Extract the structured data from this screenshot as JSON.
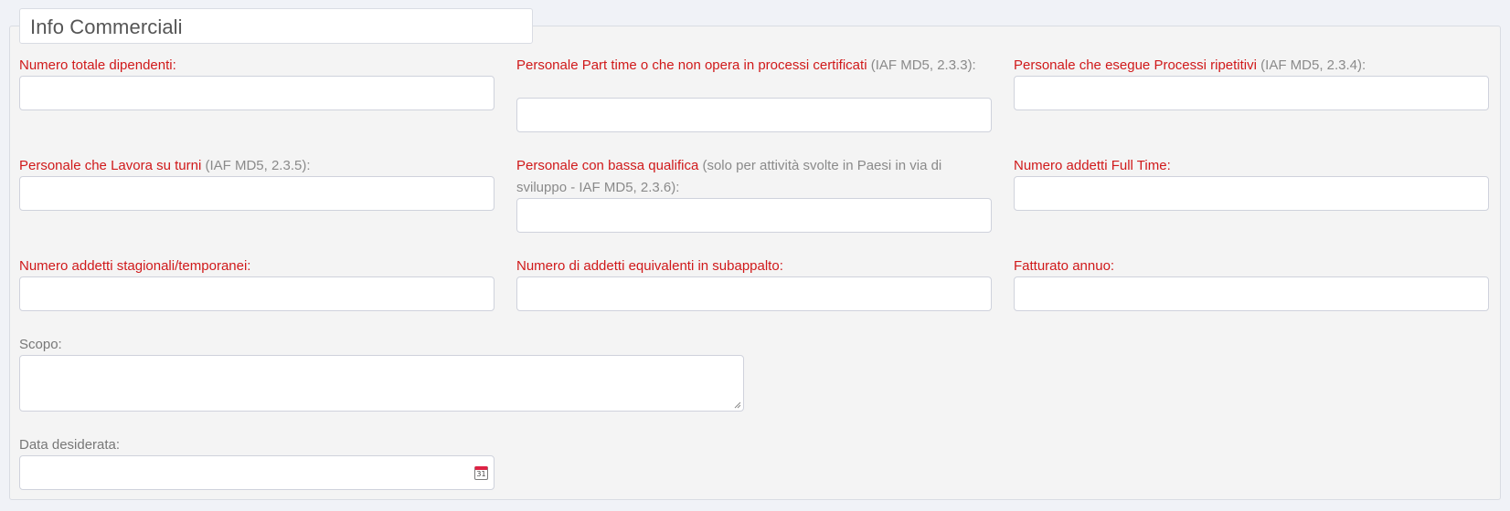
{
  "section_title": "Info Commerciali",
  "fields": {
    "f1": {
      "label": "Numero totale dipendenti:",
      "hint": "",
      "value": ""
    },
    "f2": {
      "label": "Personale Part time o che non opera in processi certificati",
      "hint": " (IAF MD5, 2.3.3):",
      "value": ""
    },
    "f3": {
      "label": "Personale che esegue Processi ripetitivi",
      "hint": " (IAF MD5, 2.3.4):",
      "value": ""
    },
    "f4": {
      "label": "Personale che Lavora su turni",
      "hint": " (IAF MD5, 2.3.5):",
      "value": ""
    },
    "f5": {
      "label": "Personale con bassa qualifica",
      "hint": " (solo per attività svolte in Paesi in via di sviluppo - IAF MD5, 2.3.6):",
      "value": ""
    },
    "f6": {
      "label": "Numero addetti Full Time:",
      "hint": "",
      "value": ""
    },
    "f7": {
      "label": "Numero addetti stagionali/temporanei:",
      "hint": "",
      "value": ""
    },
    "f8": {
      "label": "Numero di addetti equivalenti in subappalto:",
      "hint": "",
      "value": ""
    },
    "f9": {
      "label": "Fatturato annuo:",
      "hint": "",
      "value": ""
    },
    "scopo": {
      "label": "Scopo:",
      "value": ""
    },
    "data": {
      "label": "Data desiderata:",
      "value": "",
      "calendar_icon_text": "31"
    }
  },
  "colors": {
    "required": "#d0191a",
    "hint": "#8a8a8a",
    "panel": "#f4f4f4"
  }
}
